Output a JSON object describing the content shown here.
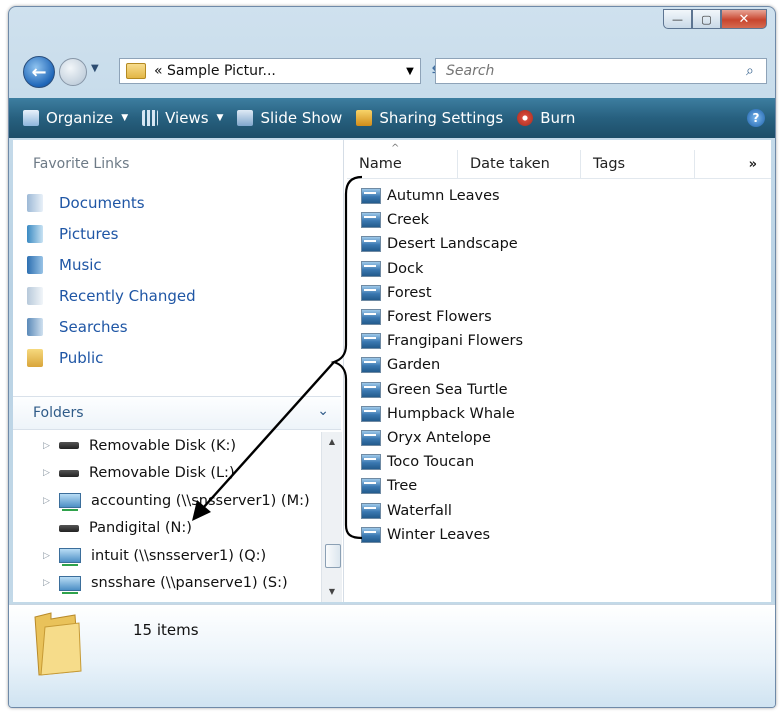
{
  "window": {
    "minimize": "—",
    "maximize": "▢",
    "close": "✕"
  },
  "address": {
    "path": "« Sample Pictur..."
  },
  "search": {
    "placeholder": "Search"
  },
  "toolbar": {
    "organize": "Organize",
    "views": "Views",
    "slideshow": "Slide Show",
    "sharing": "Sharing Settings",
    "burn": "Burn",
    "help": "?"
  },
  "favorites": {
    "header": "Favorite Links",
    "items": [
      "Documents",
      "Pictures",
      "Music",
      "Recently Changed",
      "Searches",
      "Public"
    ]
  },
  "folders": {
    "header": "Folders",
    "items": [
      "Removable Disk (K:)",
      "Removable Disk (L:)",
      "accounting (\\\\snsserver1) (M:)",
      "Pandigital (N:)",
      "intuit (\\\\snsserver1) (Q:)",
      "snsshare (\\\\panserve1) (S:)"
    ]
  },
  "columns": {
    "name": "Name",
    "date": "Date taken",
    "tags": "Tags",
    "more": "»"
  },
  "files": [
    "Autumn Leaves",
    "Creek",
    "Desert Landscape",
    "Dock",
    "Forest",
    "Forest Flowers",
    "Frangipani Flowers",
    "Garden",
    "Green Sea Turtle",
    "Humpback Whale",
    "Oryx Antelope",
    "Toco Toucan",
    "Tree",
    "Waterfall",
    "Winter Leaves"
  ],
  "details": {
    "count": "15 items"
  },
  "colors": {
    "toolbar": "#27607f",
    "link": "#1f56a5",
    "annotation": "#000000"
  }
}
